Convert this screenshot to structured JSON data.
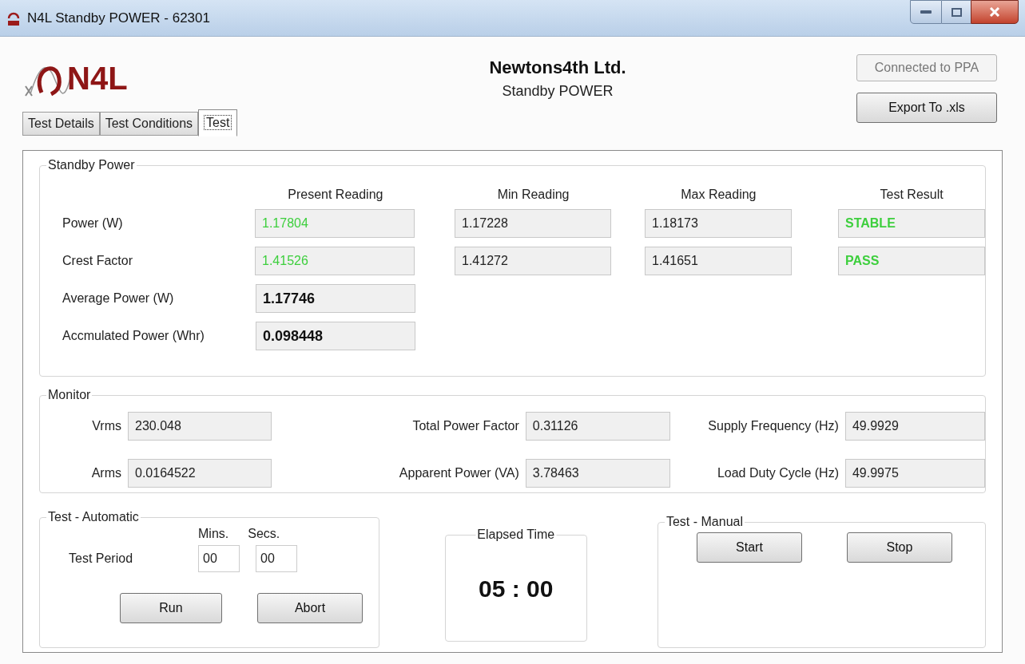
{
  "window": {
    "title": "N4L Standby POWER - 62301"
  },
  "header": {
    "logo_text": "N4L",
    "company": "Newtons4th Ltd.",
    "product": "Standby POWER"
  },
  "connection": {
    "label": "Connected to PPA",
    "disabled": true
  },
  "export_button": "Export To .xls",
  "tabs": [
    {
      "label": "Test Details",
      "selected": false
    },
    {
      "label": "Test Conditions",
      "selected": false
    },
    {
      "label": "Test",
      "selected": true
    }
  ],
  "standby_power": {
    "title": "Standby Power",
    "columns": [
      "Present Reading",
      "Min Reading",
      "Max Reading",
      "Test Result"
    ],
    "rows": [
      {
        "kind": "measured",
        "label": "Power (W)",
        "values": [
          "1.17804",
          "1.17228",
          "1.18173",
          "STABLE"
        ]
      },
      {
        "kind": "measured",
        "label": "Crest Factor",
        "values": [
          "1.41526",
          "1.41272",
          "1.41651",
          "PASS"
        ]
      },
      {
        "kind": "summary",
        "label": "Average Power (W)",
        "values": [
          "1.17746"
        ]
      },
      {
        "kind": "summary",
        "label": "Accmulated Power (Whr)",
        "values": [
          "0.098448"
        ]
      }
    ]
  },
  "monitor": {
    "title": "Monitor",
    "fields": [
      {
        "label": "Vrms",
        "value": "230.048"
      },
      {
        "label": "Total Power Factor",
        "value": "0.31126"
      },
      {
        "label": "Supply Frequency (Hz)",
        "value": "49.9929"
      },
      {
        "label": "Arms",
        "value": "0.0164522"
      },
      {
        "label": "Apparent Power (VA)",
        "value": "3.78463"
      },
      {
        "label": "Load Duty Cycle (Hz)",
        "value": "49.9975"
      }
    ]
  },
  "test_automatic": {
    "title": "Test - Automatic",
    "period_label": "Test Period",
    "mins_label": "Mins.",
    "secs_label": "Secs.",
    "mins": "00",
    "secs": "00",
    "buttons": [
      "Run",
      "Abort"
    ]
  },
  "elapsed_time": {
    "title": "Elapsed Time",
    "value": "05 : 00"
  },
  "test_manual": {
    "title": "Test - Manual",
    "buttons": [
      "Start",
      "Stop"
    ]
  }
}
